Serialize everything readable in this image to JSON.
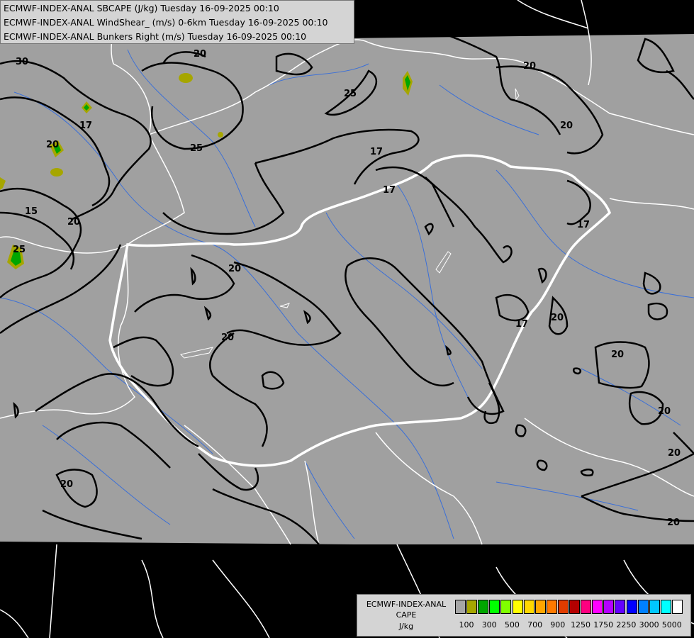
{
  "header": {
    "line1": "ECMWF-INDEX-ANAL SBCAPE (J/kg) Tuesday 16-09-2025 00:10",
    "line2": "ECMWF-INDEX-ANAL WindShear_ (m/s) 0-6km Tuesday 16-09-2025 00:10",
    "line3": "ECMWF-INDEX-ANAL Bunkers Right (m/s) Tuesday 16-09-2025 00:10"
  },
  "legend": {
    "title1": "ECMWF-INDEX-ANAL",
    "title2": "CAPE",
    "title3": "J/kg",
    "colors": [
      "#a6a6a6",
      "#a6a600",
      "#00a600",
      "#00ff00",
      "#80ff00",
      "#ffff00",
      "#ffd800",
      "#ffa600",
      "#ff7a00",
      "#e03c00",
      "#b40000",
      "#ff0080",
      "#ff00ff",
      "#b400ff",
      "#6400ff",
      "#0000ff",
      "#0080ff",
      "#00c8ff",
      "#00ffff",
      "#ffffff"
    ],
    "ticks": [
      "100",
      "300",
      "500",
      "700",
      "900",
      "1250",
      "1750",
      "2250",
      "3000",
      "5000"
    ]
  },
  "map": {
    "contour_labels": [
      "30",
      "20",
      "25",
      "17",
      "20",
      "15",
      "20",
      "20",
      "25",
      "17",
      "17",
      "25",
      "20",
      "20",
      "20",
      "17",
      "20",
      "20",
      "17",
      "20",
      "20",
      "20",
      "20",
      "20"
    ],
    "colors": {
      "domain_fill": "#a0a0a0",
      "outside": "#000000",
      "borders": "#ffffff",
      "rivers": "#3a6fd8",
      "contours": "#000000",
      "cape_low": "#a6a600",
      "cape_mid": "#00a600"
    }
  }
}
